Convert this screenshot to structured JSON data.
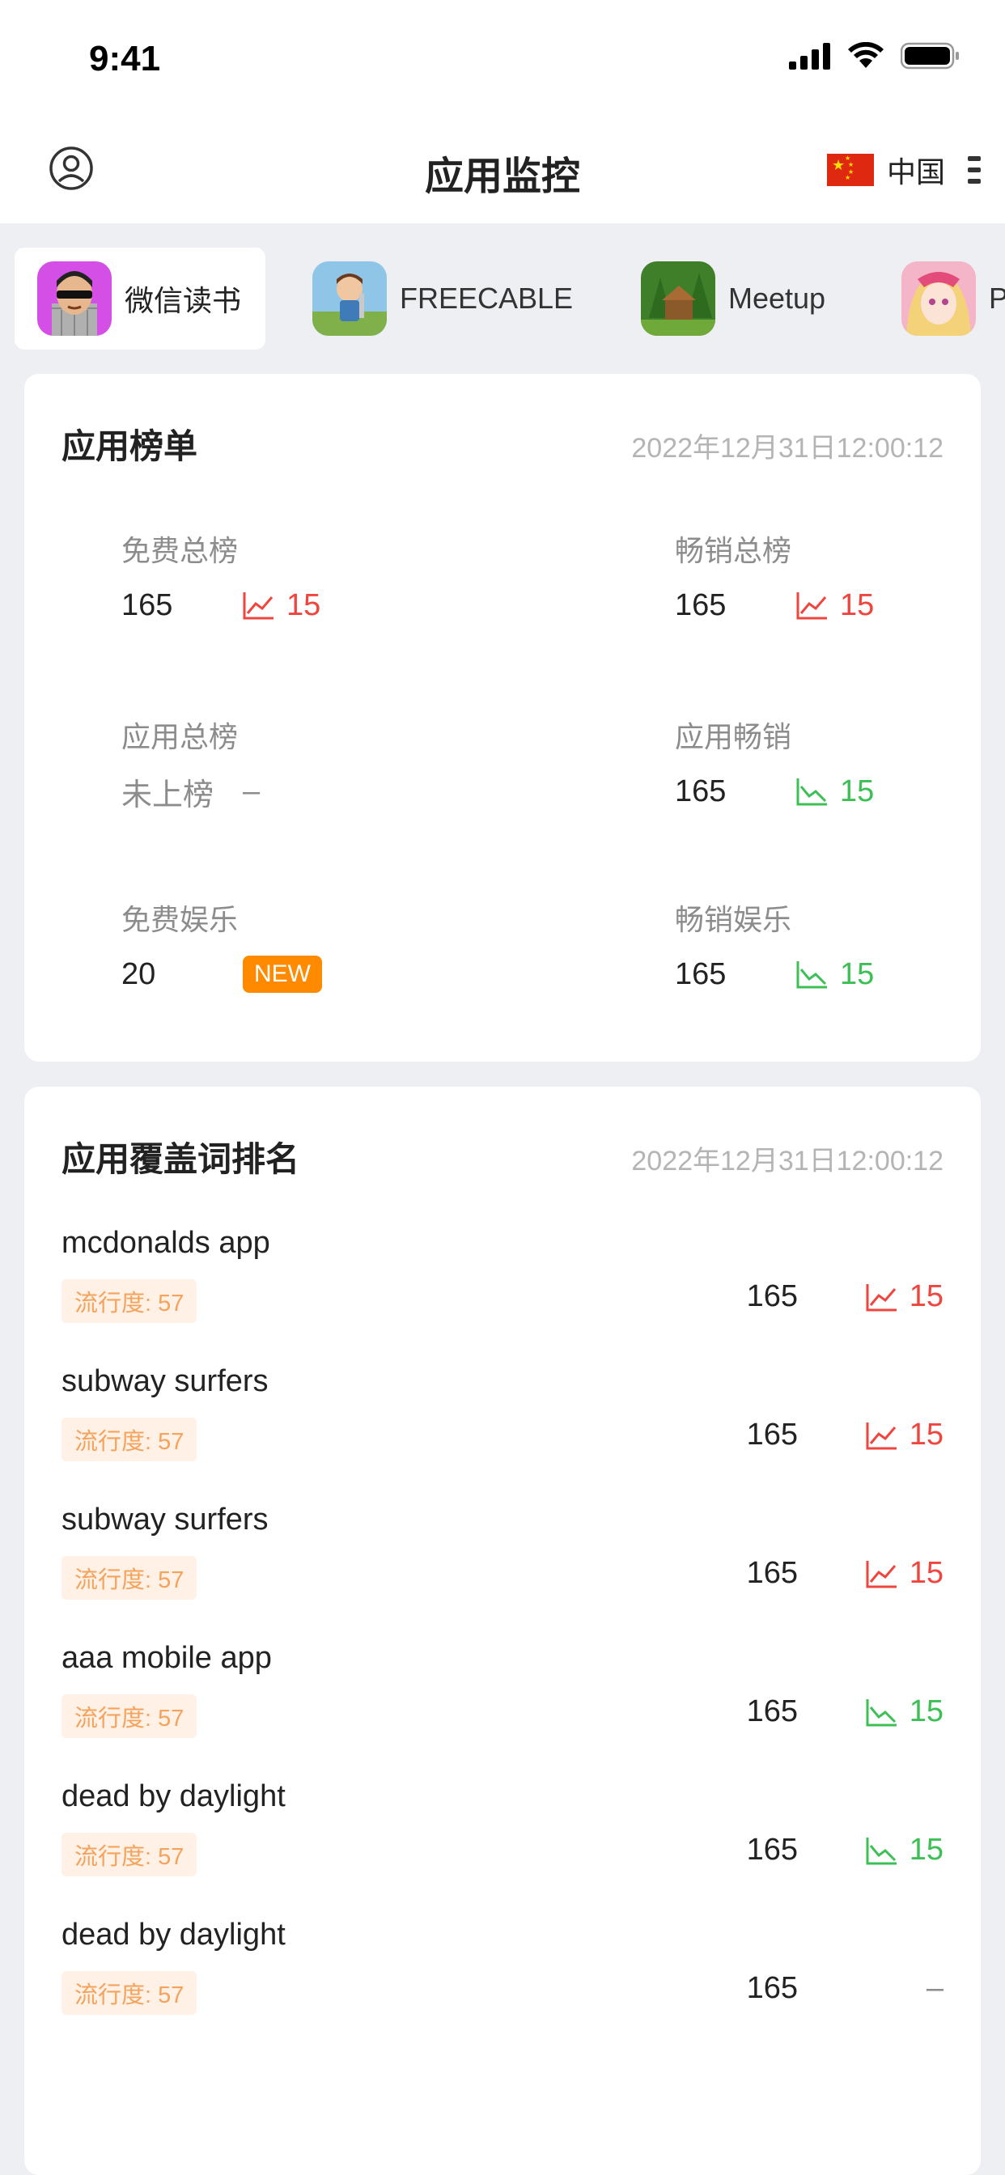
{
  "status_bar": {
    "time": "9:41"
  },
  "nav": {
    "title": "应用监控",
    "region": "中国"
  },
  "tabs": [
    {
      "label": "微信读书",
      "active": true
    },
    {
      "label": "FREECABLE",
      "active": false
    },
    {
      "label": "Meetup",
      "active": false
    },
    {
      "label": "P",
      "active": false
    }
  ],
  "rankings": {
    "title": "应用榜单",
    "timestamp": "2022年12月31日12:00:12",
    "items": [
      {
        "name": "免费总榜",
        "value": "165",
        "trend": "up",
        "change": "15"
      },
      {
        "name": "畅销总榜",
        "value": "165",
        "trend": "up",
        "change": "15"
      },
      {
        "name": "应用总榜",
        "value": "未上榜",
        "trend": "none",
        "change": "–"
      },
      {
        "name": "应用畅销",
        "value": "165",
        "trend": "down",
        "change": "15"
      },
      {
        "name": "免费娱乐",
        "value": "20",
        "trend": "new",
        "change": "NEW"
      },
      {
        "name": "畅销娱乐",
        "value": "165",
        "trend": "down",
        "change": "15"
      }
    ]
  },
  "keywords": {
    "title": "应用覆盖词排名",
    "timestamp": "2022年12月31日12:00:12",
    "items": [
      {
        "name": "mcdonalds app",
        "popularity": "流行度: 57",
        "rank": "165",
        "trend": "up",
        "change": "15"
      },
      {
        "name": "subway surfers",
        "popularity": "流行度: 57",
        "rank": "165",
        "trend": "up",
        "change": "15"
      },
      {
        "name": "subway surfers",
        "popularity": "流行度: 57",
        "rank": "165",
        "trend": "up",
        "change": "15"
      },
      {
        "name": "aaa mobile app",
        "popularity": "流行度: 57",
        "rank": "165",
        "trend": "down",
        "change": "15"
      },
      {
        "name": "dead by daylight",
        "popularity": "流行度: 57",
        "rank": "165",
        "trend": "down",
        "change": "15"
      },
      {
        "name": "dead by daylight",
        "popularity": "流行度: 57",
        "rank": "165",
        "trend": "none",
        "change": "–"
      }
    ]
  },
  "colors": {
    "up": "#F0453E",
    "down": "#3CBF55",
    "new_badge": "#FF8A00",
    "popularity": "#F5A35C"
  }
}
